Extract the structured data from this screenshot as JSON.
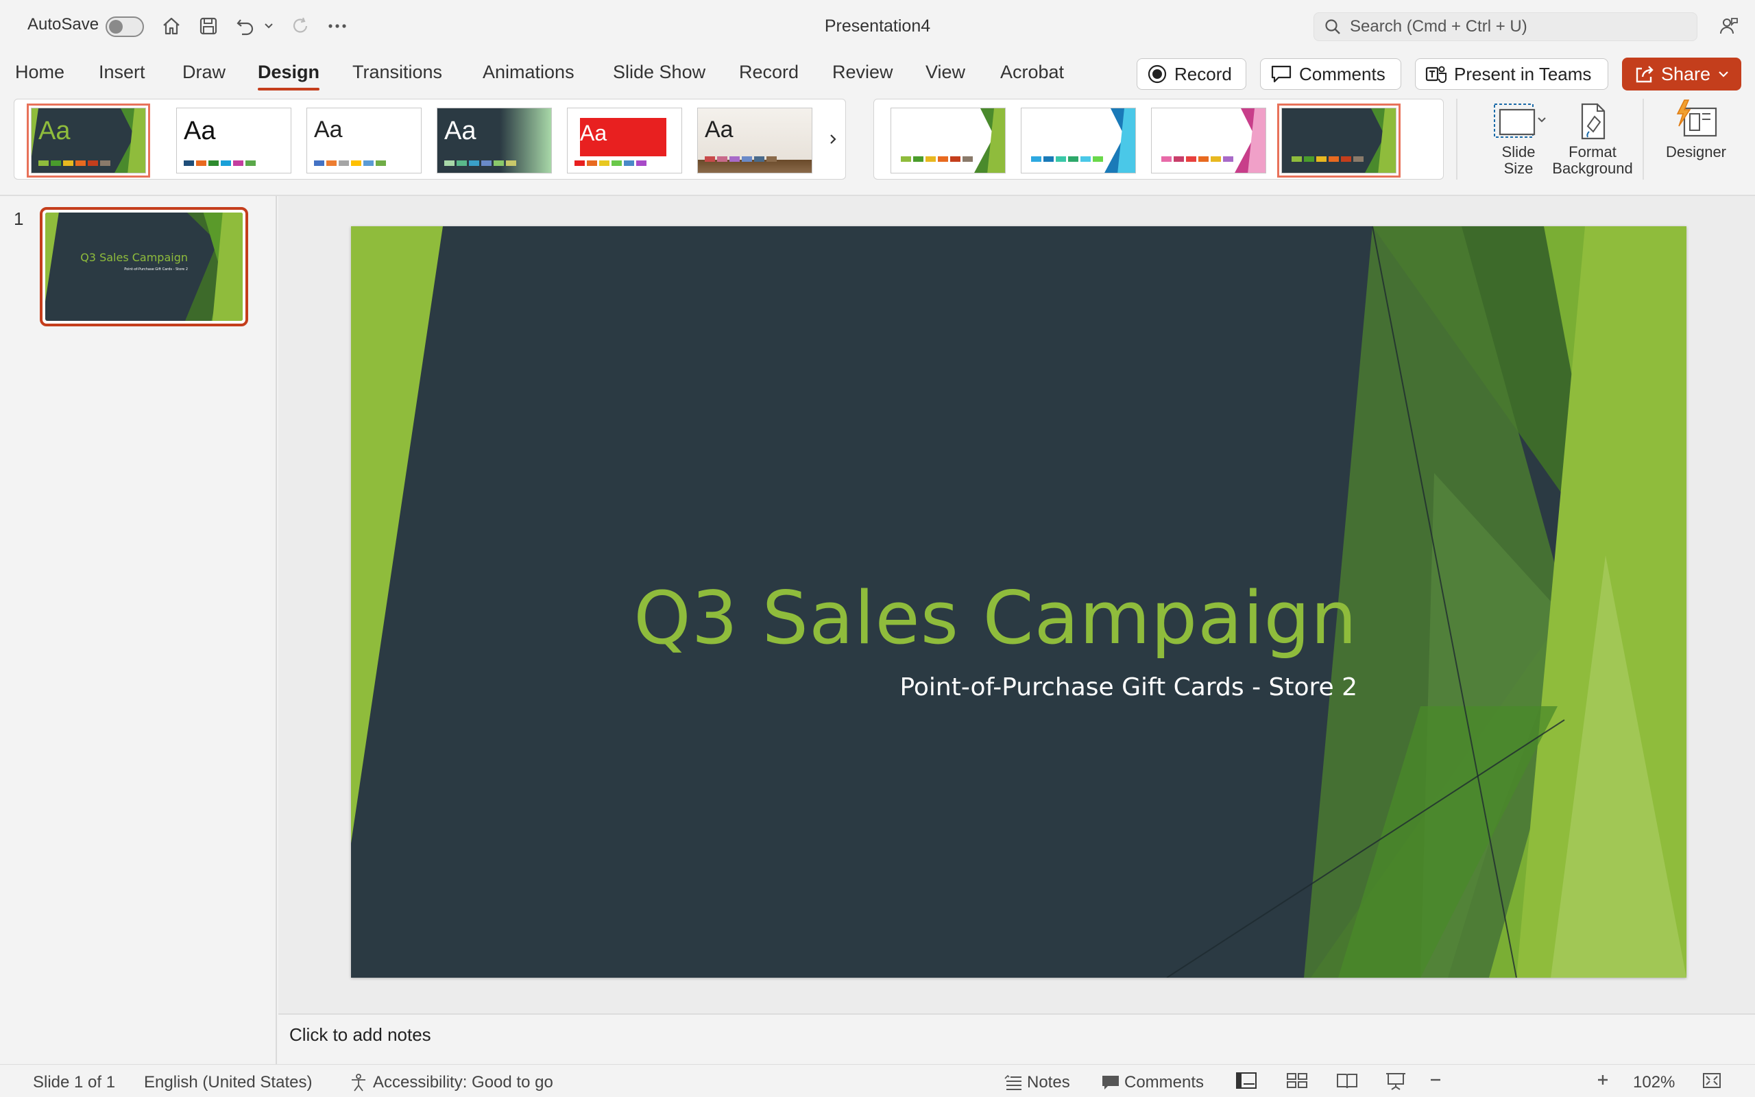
{
  "titlebar": {
    "autosave_label": "AutoSave",
    "autosave_on": false,
    "document_title": "Presentation4",
    "search_placeholder": "Search (Cmd + Ctrl + U)"
  },
  "tabs": [
    {
      "label": "Home",
      "active": false
    },
    {
      "label": "Insert",
      "active": false
    },
    {
      "label": "Draw",
      "active": false
    },
    {
      "label": "Design",
      "active": true
    },
    {
      "label": "Transitions",
      "active": false
    },
    {
      "label": "Animations",
      "active": false
    },
    {
      "label": "Slide Show",
      "active": false
    },
    {
      "label": "Record",
      "active": false
    },
    {
      "label": "Review",
      "active": false
    },
    {
      "label": "View",
      "active": false
    },
    {
      "label": "Acrobat",
      "active": false
    }
  ],
  "actions": {
    "record_label": "Record",
    "comments_label": "Comments",
    "present_teams_label": "Present in Teams",
    "share_label": "Share"
  },
  "ribbon": {
    "themes": [
      {
        "aa": "Aa",
        "style": "facet-dark",
        "colors": [
          "#8fbc3c",
          "#4a9c2c",
          "#e8b820",
          "#e86a20",
          "#c43e1c",
          "#8a7a6a"
        ]
      },
      {
        "aa": "Aa",
        "style": "office",
        "colors": [
          "#1f4e79",
          "#e86a20",
          "#2e8b2e",
          "#1aa0d8",
          "#c43ea0",
          "#5aa84a"
        ]
      },
      {
        "aa": "Aa",
        "style": "office-light",
        "colors": [
          "#4472c4",
          "#ed7d31",
          "#a5a5a5",
          "#ffc000",
          "#5b9bd5",
          "#70ad47"
        ]
      },
      {
        "aa": "Aa",
        "style": "green-dark",
        "colors": [
          "#a8d8a8",
          "#5ab88a",
          "#3aa0c8",
          "#6a8ac8",
          "#8ac86a",
          "#c8c86a"
        ]
      },
      {
        "aa": "Aa",
        "style": "red-banner",
        "colors": [
          "#e82020",
          "#e86a20",
          "#e8c820",
          "#6ac84a",
          "#4a8ac8",
          "#a84ac8"
        ]
      },
      {
        "aa": "Aa",
        "style": "wood",
        "colors": [
          "#c84a4a",
          "#c86a8a",
          "#a86ac8",
          "#6a8ac8",
          "#4a6a8a",
          "#8a6a4a"
        ]
      }
    ],
    "variants": [
      {
        "bg": "#ffffff",
        "accent": "#8fbc3c",
        "colors": [
          "#8fbc3c",
          "#4a9c2c",
          "#e8b820",
          "#e86a20",
          "#c43e1c",
          "#8a7a6a"
        ]
      },
      {
        "bg": "#ffffff",
        "accent": "#2ea8e0",
        "colors": [
          "#2ea8e0",
          "#1a7ab8",
          "#3ac8a8",
          "#2ea86a",
          "#4ac8e8",
          "#6ad84a"
        ]
      },
      {
        "bg": "#ffffff",
        "accent": "#e83ea0",
        "colors": [
          "#e86aa8",
          "#c83e6a",
          "#e8403e",
          "#e86a20",
          "#e8b820",
          "#a86ac8"
        ]
      },
      {
        "bg": "#2b3a43",
        "accent": "#8fbc3c",
        "colors": [
          "#8fbc3c",
          "#4a9c2c",
          "#e8b820",
          "#e86a20",
          "#c43e1c",
          "#8a7a6a"
        ]
      }
    ],
    "slide_size_label": "Slide\nSize",
    "format_background_label": "Format\nBackground",
    "designer_label": "Designer"
  },
  "slides_panel": {
    "slide_number": "1",
    "thumb_title": "Q3 Sales Campaign",
    "thumb_subtitle": "Point-of-Purchase Gift Cards - Store 2"
  },
  "slide": {
    "title": "Q3 Sales Campaign",
    "subtitle": "Point-of-Purchase Gift Cards - Store 2",
    "background": "#2b3a43",
    "accent": "#8fbc3c"
  },
  "notes_placeholder": "Click to add notes",
  "statusbar": {
    "slide_info": "Slide 1 of 1",
    "language": "English (United States)",
    "accessibility": "Accessibility: Good to go",
    "notes_label": "Notes",
    "comments_label": "Comments",
    "zoom": "102%"
  }
}
